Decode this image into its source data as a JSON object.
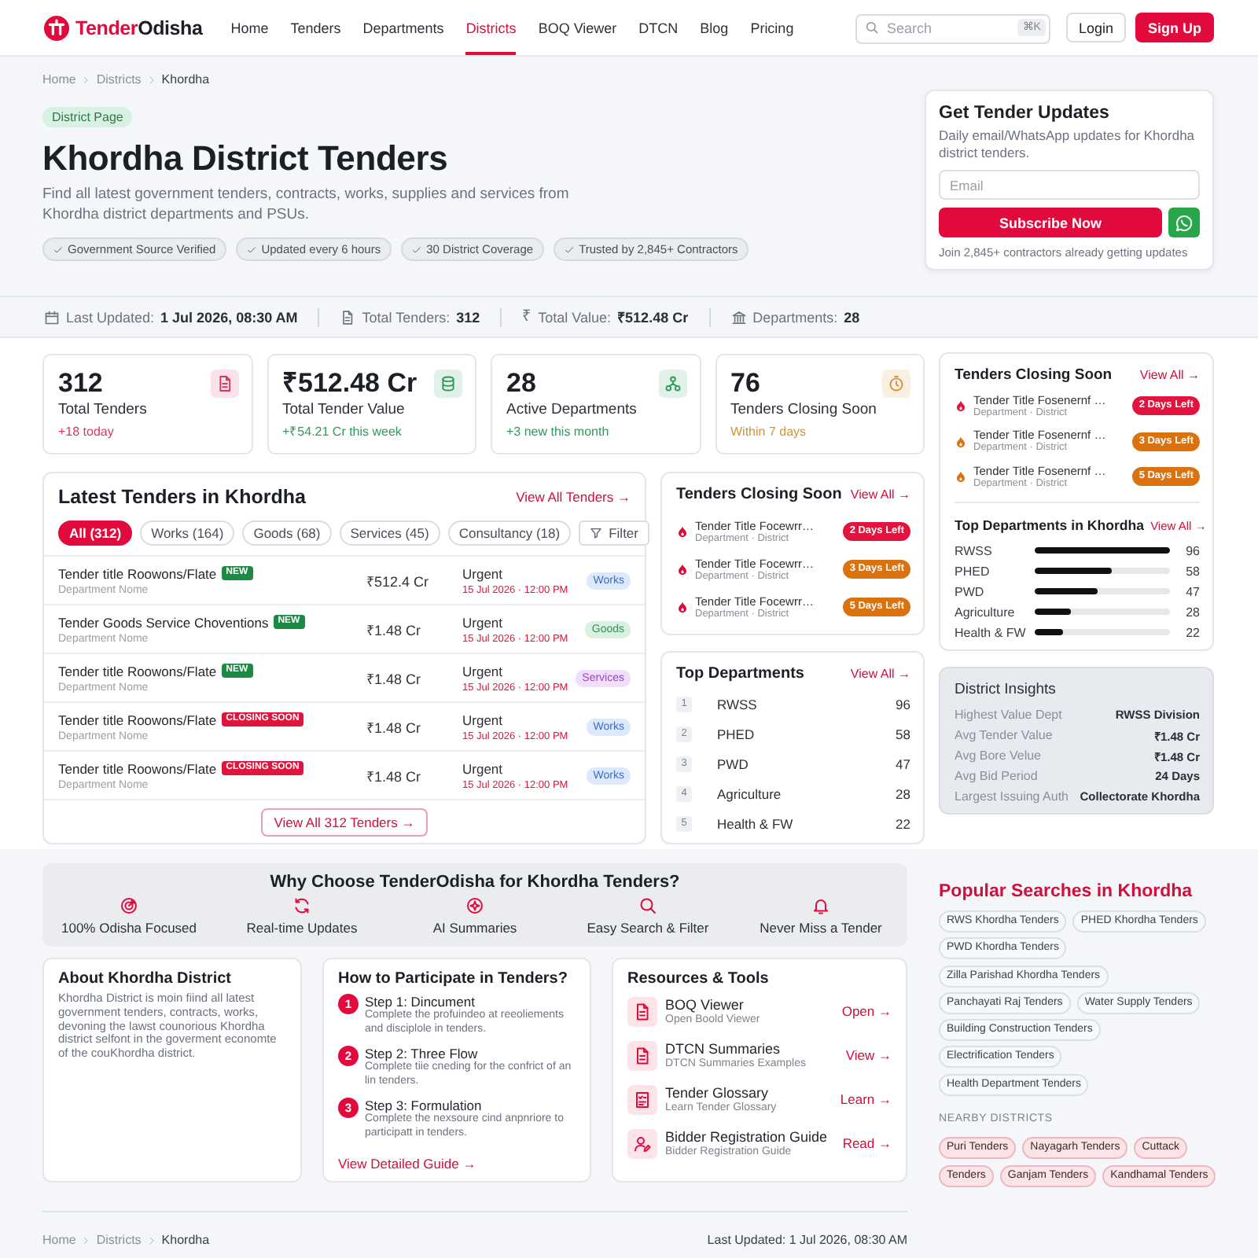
{
  "header": {
    "logo": {
      "part1": "Tender",
      "part2": "Odisha"
    },
    "nav": [
      {
        "label": "Home",
        "selected": false
      },
      {
        "label": "Tenders",
        "selected": false
      },
      {
        "label": "Departments",
        "selected": false
      },
      {
        "label": "Districts",
        "selected": true
      },
      {
        "label": "BOQ Viewer",
        "selected": false
      },
      {
        "label": "DTCN",
        "selected": false
      },
      {
        "label": "Blog",
        "selected": false
      },
      {
        "label": "Pricing",
        "selected": false
      }
    ],
    "search": {
      "placeholder": "Search",
      "shortcut": "⌘K"
    },
    "login": "Login",
    "signup": "Sign Up"
  },
  "hero": {
    "breadcrumb": [
      "Home",
      "Districts",
      "Khordha"
    ],
    "badge": "District Page",
    "title": "Khordha District Tenders",
    "description": "Find all latest government tenders, contracts, works, supplies and services from Khordha district departments and PSUs.",
    "chips": [
      "Government Source Verified",
      "Updated every 6 hours",
      "30 District Coverage",
      "Trusted by 2,845+ Contractors"
    ]
  },
  "subscribe": {
    "title": "Get Tender Updates",
    "text": "Daily email/WhatsApp updates for Khordha district tenders.",
    "placeholder": "Email",
    "button": "Subscribe Now",
    "note": "Join 2,845+ contractors already getting updates"
  },
  "info_bar": [
    {
      "kind": "calendar",
      "label": "Last Updated:",
      "value": "1 Jul 2026, 08:30 AM"
    },
    {
      "kind": "document",
      "label": "Total Tenders:",
      "value": "312"
    },
    {
      "kind": "glyph",
      "glyph": "₹",
      "label": "Total Value:",
      "value": "₹512.48 Cr"
    },
    {
      "kind": "bank",
      "label": "Departments:",
      "value": "28"
    }
  ],
  "stats": [
    {
      "kind": "document",
      "value": "312",
      "label": "Total Tenders",
      "delta": "+18 today",
      "color": "#d6395f"
    },
    {
      "kind": "database",
      "value": "₹512.48 Cr",
      "label": "Total Tender Value",
      "delta": "+₹54.21 Cr this week",
      "color": "#2f9a5a"
    },
    {
      "kind": "network",
      "value": "28",
      "label": "Active Departments",
      "delta": "+3 new this month",
      "color": "#2f9a5a"
    },
    {
      "kind": "timer",
      "value": "76",
      "label": "Tenders Closing Soon",
      "delta": "Within 7 days",
      "color": "#d4923a"
    }
  ],
  "latest": {
    "title": "Latest Tenders in Khordha",
    "link": "View All Tenders →",
    "filters": [
      {
        "label": "All (312)",
        "selected": true
      },
      {
        "label": "Works (164)",
        "selected": false
      },
      {
        "label": "Goods (68)",
        "selected": false
      },
      {
        "label": "Services (45)",
        "selected": false
      },
      {
        "label": "Consultancy (18)",
        "selected": false
      }
    ],
    "filter_button": "Filter",
    "rows": [
      {
        "title": "Tender title Roowons/Flate",
        "badge": {
          "text": "NEW",
          "kind": "new"
        },
        "department": "Department Nome",
        "value": "₹512.4 Cr",
        "status": "Urgent",
        "deadline": "15 Jul 2026 · 12:00 PM",
        "category": {
          "text": "Works",
          "kind": "works"
        }
      },
      {
        "title": "Tender Goods Service Choventions",
        "badge": {
          "text": "NEW",
          "kind": "new"
        },
        "department": "Department Nome",
        "value": "₹1.48 Cr",
        "status": "Urgent",
        "deadline": "15 Jul 2026 · 12:00 PM",
        "category": {
          "text": "Goods",
          "kind": "goods"
        }
      },
      {
        "title": "Tender title Roowons/Flate",
        "badge": {
          "text": "NEW",
          "kind": "new"
        },
        "department": "Department Nome",
        "value": "₹1.48 Cr",
        "status": "Urgent",
        "deadline": "15 Jul 2026 · 12:00 PM",
        "category": {
          "text": "Services",
          "kind": "services"
        }
      },
      {
        "title": "Tender title Roowons/Flate",
        "badge": {
          "text": "CLOSING SOON",
          "kind": "closing"
        },
        "department": "Department Nome",
        "value": "₹1.48 Cr",
        "status": "Urgent",
        "deadline": "15 Jul 2026 · 12:00 PM",
        "category": {
          "text": "Works",
          "kind": "works"
        }
      },
      {
        "title": "Tender title Roowons/Flate",
        "badge": {
          "text": "CLOSING SOON",
          "kind": "closing"
        },
        "department": "Department Nome",
        "value": "₹1.48 Cr",
        "status": "Urgent",
        "deadline": "15 Jul 2026 · 12:00 PM",
        "category": {
          "text": "Works",
          "kind": "works"
        }
      }
    ],
    "footer_button": "View All 312 Tenders →"
  },
  "closing_soon": {
    "title": "Tenders Closing Soon",
    "link": "View All →",
    "items": [
      {
        "title": "Tender Title Focewrr…",
        "meta": "Department · District",
        "badge": "2 Days Left",
        "color": "#e0143c"
      },
      {
        "title": "Tender Title Focewrr…",
        "meta": "Department · District",
        "badge": "3 Days Left",
        "color": "#d9720f"
      },
      {
        "title": "Tender Title Focewrr…",
        "meta": "Department · District",
        "badge": "5 Days Left",
        "color": "#d9720f"
      }
    ]
  },
  "top_departments": {
    "title": "Top Departments",
    "link": "View All →",
    "items": [
      {
        "rank": "1",
        "name": "RWSS",
        "count": "96"
      },
      {
        "rank": "2",
        "name": "PHED",
        "count": "58"
      },
      {
        "rank": "3",
        "name": "PWD",
        "count": "47"
      },
      {
        "rank": "4",
        "name": "Agriculture",
        "count": "28"
      },
      {
        "rank": "5",
        "name": "Health & FW",
        "count": "22"
      }
    ]
  },
  "sidebar_closing": {
    "title": "Tenders Closing Soon",
    "link": "View All →",
    "items": [
      {
        "title": "Tender Title Fosenernf …",
        "meta": "Department · District",
        "badge": "2 Days Left",
        "color": "#e0143c"
      },
      {
        "title": "Tender Title Fosenernf …",
        "meta": "Department · District",
        "badge": "3 Days Left",
        "color": "#d9720f"
      },
      {
        "title": "Tender Title Fosenernf …",
        "meta": "Department · District",
        "badge": "5 Days Left",
        "color": "#d9720f"
      }
    ]
  },
  "sidebar_departments": {
    "title": "Top Departments in Khordha",
    "link": "View All →",
    "items": [
      {
        "name": "RWSS",
        "count": "96",
        "level": 1.0
      },
      {
        "name": "PHED",
        "count": "58",
        "level": 0.57
      },
      {
        "name": "PWD",
        "count": "47",
        "level": 0.46
      },
      {
        "name": "Agriculture",
        "count": "28",
        "level": 0.27
      },
      {
        "name": "Health & FW",
        "count": "22",
        "level": 0.21
      }
    ]
  },
  "insights": {
    "title": "District Insights",
    "rows": [
      {
        "label": "Highest Value Dept",
        "value": "RWSS Division"
      },
      {
        "label": "Avg Tender Value",
        "value": "₹1.48 Cr"
      },
      {
        "label": "Avg Bore Velue",
        "value": "₹1.48 Cr"
      },
      {
        "label": "Avg Bid Period",
        "value": "24 Days"
      },
      {
        "label": "Largest Issuing Auth",
        "value": "Collectorate Khordha"
      }
    ]
  },
  "why_choose": {
    "title": "Why Choose TenderOdisha for Khordha Tenders?",
    "features": [
      {
        "kind": "target",
        "label": "100% Odisha Focused"
      },
      {
        "kind": "refresh",
        "label": "Real-time Updates"
      },
      {
        "kind": "sparkle",
        "label": "AI Summaries"
      },
      {
        "kind": "search",
        "label": "Easy Search & Filter"
      },
      {
        "kind": "bell",
        "label": "Never Miss a Tender"
      }
    ]
  },
  "about": {
    "title": "About Khordha District",
    "text": "Khordha District is moin fiind all latest government tenders, contracts, works, devoning the lawst counorious Khordha district selfont in the goverment economte of the couKhordha district."
  },
  "participate": {
    "title": "How to Participate in Tenders?",
    "steps": [
      {
        "number": "1",
        "title": "Step 1: Dincument",
        "text": "Complete the profuindeo at reeoliements and disciplole in tenders."
      },
      {
        "number": "2",
        "title": "Step 2: Three Flow",
        "text": "Complete tiie cneding for the confrict of an lin tenders."
      },
      {
        "number": "3",
        "title": "Step 3: Formulation",
        "text": "Complete the nexsoure cind anpnriore to participatt in tenders."
      }
    ],
    "link": "View Detailed Guide →"
  },
  "resources": {
    "title": "Resources & Tools",
    "items": [
      {
        "kind": "document",
        "title": "BOQ Viewer",
        "subtitle": "Open Boold Viewer",
        "action": "Open →"
      },
      {
        "kind": "document",
        "title": "DTCN Summaries",
        "subtitle": "DTCN Summaries Examples",
        "action": "View →"
      },
      {
        "kind": "checklist",
        "title": "Tender Glossary",
        "subtitle": "Learn Tender Glossary",
        "action": "Learn →"
      },
      {
        "kind": "person",
        "title": "Bidder Registration Guide",
        "subtitle": "Bidder Registration Guide",
        "action": "Read →"
      }
    ]
  },
  "popular": {
    "title": "Popular Searches in Khordha",
    "tag_rows": [
      [
        "RWS Khordha Tenders",
        "PHED Khordha Tenders"
      ],
      [
        "PWD Khordha Tenders"
      ],
      [
        "Zilla Parishad Khordha Tenders"
      ],
      [
        "Panchayati Raj Tenders",
        "Water Supply Tenders"
      ],
      [
        "Building Construction Tenders"
      ],
      [
        "Electrification Tenders"
      ],
      [
        "Health Department Tenders"
      ]
    ],
    "nearby_label": "NEARBY DISTRICTS",
    "nearby_rows": [
      [
        "Puri Tenders",
        "Nayagarh Tenders",
        "Cuttack"
      ],
      [
        "Tenders",
        "Ganjam Tenders",
        "Kandhamal Tenders"
      ]
    ]
  },
  "footer": {
    "breadcrumb": [
      "Home",
      "Districts",
      "Khordha"
    ],
    "updated": "Last Updated: 1 Jul 2026, 08:30 AM"
  }
}
